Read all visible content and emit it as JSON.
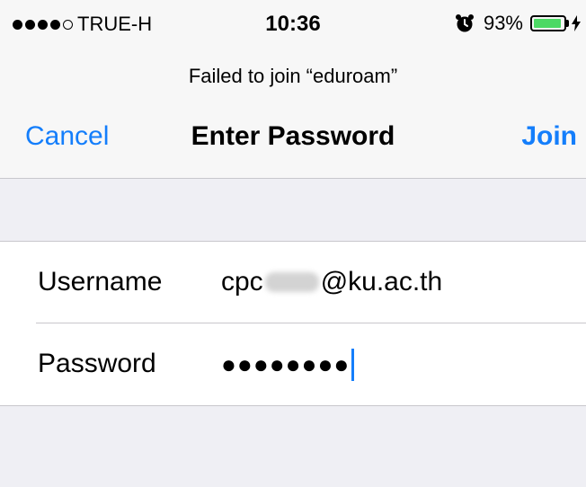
{
  "status_bar": {
    "signal_filled": 4,
    "signal_total": 5,
    "carrier": "TRUE-H",
    "time": "10:36",
    "battery_percent": "93%",
    "battery_level": 0.93,
    "battery_color": "#4cd964"
  },
  "prompt": "Failed to join “eduroam”",
  "nav": {
    "cancel_label": "Cancel",
    "title": "Enter Password",
    "join_label": "Join"
  },
  "form": {
    "username_label": "Username",
    "username_prefix": "cpc",
    "username_suffix": "@ku.ac.th",
    "password_label": "Password",
    "password_masked": "●●●●●●●●"
  },
  "colors": {
    "accent": "#147efb",
    "background": "#efeff4"
  }
}
